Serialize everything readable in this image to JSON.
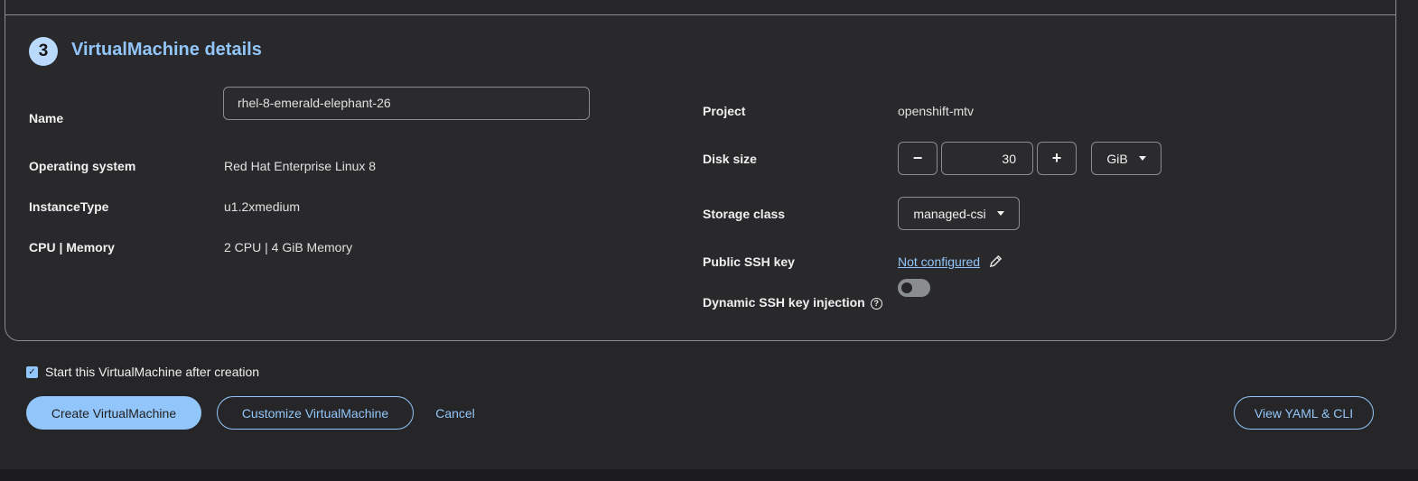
{
  "step": {
    "number": "3",
    "title": "VirtualMachine details"
  },
  "left": {
    "name_label": "Name",
    "name_value": "rhel-8-emerald-elephant-26",
    "os_label": "Operating system",
    "os_value": "Red Hat Enterprise Linux 8",
    "instancetype_label": "InstanceType",
    "instancetype_value": "u1.2xmedium",
    "cpu_label": "CPU | Memory",
    "cpu_value": "2 CPU | 4 GiB Memory"
  },
  "right": {
    "project_label": "Project",
    "project_value": "openshift-mtv",
    "disk_label": "Disk size",
    "disk_minus": "−",
    "disk_value": "30",
    "disk_plus": "+",
    "disk_unit": "GiB",
    "storage_label": "Storage class",
    "storage_value": "managed-csi",
    "ssh_label": "Public SSH key",
    "ssh_value": "Not configured",
    "dyn_label": "Dynamic SSH key injection",
    "dyn_help": "?",
    "dyn_enabled": false
  },
  "footer": {
    "start_checkbox_label": "Start this VirtualMachine after creation",
    "start_checked": true,
    "create_button": "Create VirtualMachine",
    "customize_button": "Customize VirtualMachine",
    "cancel_button": "Cancel",
    "yaml_button": "View YAML & CLI"
  },
  "colors": {
    "accent": "#92c5f9",
    "badge": "#b9dafc",
    "background": "#262628"
  },
  "icons": {
    "edit": "pencil-icon",
    "check": "checkmark-icon",
    "caret": "caret-down-icon",
    "help": "help-circle-icon"
  }
}
